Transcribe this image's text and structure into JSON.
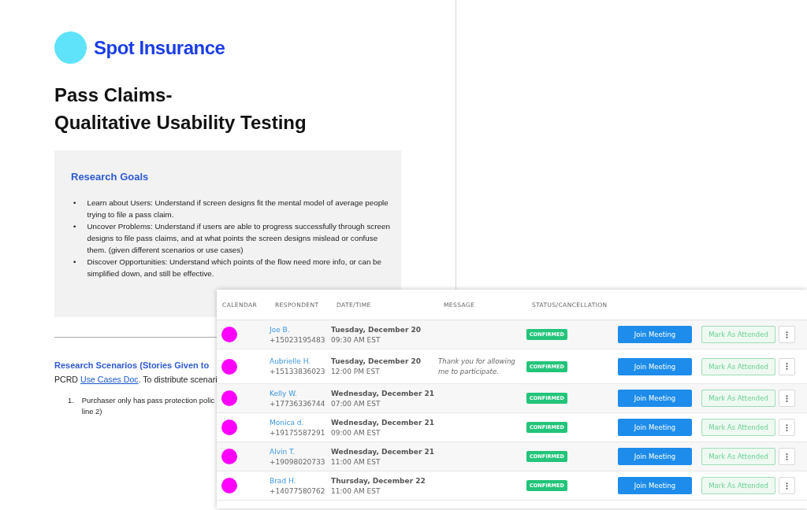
{
  "document": {
    "brand": "Spot Insurance",
    "title_lines": [
      "Pass Claims-",
      "Qualitative Usability Testing"
    ],
    "goals": {
      "heading": "Research Goals",
      "marker": "•",
      "bullets": [
        "Learn about Users: Understand if screen designs fit the mental model of average people trying to file a pass claim.",
        "Uncover Problems: Understand if users are able to progress successfully through screen designs to file pass claims, and at what points the screen designs mislead or confuse them. (given different scenarios or use cases)",
        "Discover Opportunities: Understand which points of the flow need more info, or can be simplified down, and still be effective."
      ]
    },
    "scenarios": {
      "heading": "Research Scenarios (Stories Given to",
      "intro_before": "PCRD",
      "intro_link": "Use Cases Doc",
      "intro_after": ". To distribute scenari",
      "items": [
        {
          "number": "1.",
          "lines": [
            "Purchaser only has pass protection polic",
            "line 2)"
          ]
        }
      ]
    }
  },
  "table": {
    "columns": [
      "CALENDAR",
      "RESPONDENT",
      "DATE/TIME",
      "MESSAGE",
      "STATUS/CANCELLATION"
    ],
    "rows": [
      {
        "color": "#ff00ff",
        "name": "Joe B.",
        "phone": "+15023195483",
        "date": "Tuesday, December 20",
        "time": "09:30 AM EST",
        "status": "CONFIRMED",
        "join": "Join Meeting",
        "mark": "Mark As Attended"
      },
      {
        "color": "#ff00ff",
        "name": "Aubrielle H.",
        "phone": "+15133836023",
        "date": "Tuesday, December 20",
        "time": "12:00 PM EST",
        "message": "Thank you for allowing me to participate.",
        "status": "CONFIRMED",
        "join": "Join Meeting",
        "mark": "Mark As Attended"
      },
      {
        "color": "#ff00ff",
        "name": "Kelly W.",
        "phone": "+17736336744",
        "date": "Wednesday, December 21",
        "time": "07:00 AM EST",
        "status": "CONFIRMED",
        "join": "Join Meeting",
        "mark": "Mark As Attended"
      },
      {
        "color": "#ff00ff",
        "name": "Monica d.",
        "phone": "+19175587291",
        "date": "Wednesday, December 21",
        "time": "09:00 AM EST",
        "status": "CONFIRMED",
        "join": "Join Meeting",
        "mark": "Mark As Attended"
      },
      {
        "color": "#ff00ff",
        "name": "Alvin T.",
        "phone": "+19098020733",
        "date": "Wednesday, December 21",
        "time": "11:00 AM EST",
        "status": "CONFIRMED",
        "join": "Join Meeting",
        "mark": "Mark As Attended"
      },
      {
        "color": "#ff00ff",
        "name": "Brad H.",
        "phone": "+14077580762",
        "date": "Thursday, December 22",
        "time": "11:00 AM EST",
        "status": "CONFIRMED",
        "join": "Join Meeting",
        "mark": "Mark As Attended"
      }
    ]
  }
}
